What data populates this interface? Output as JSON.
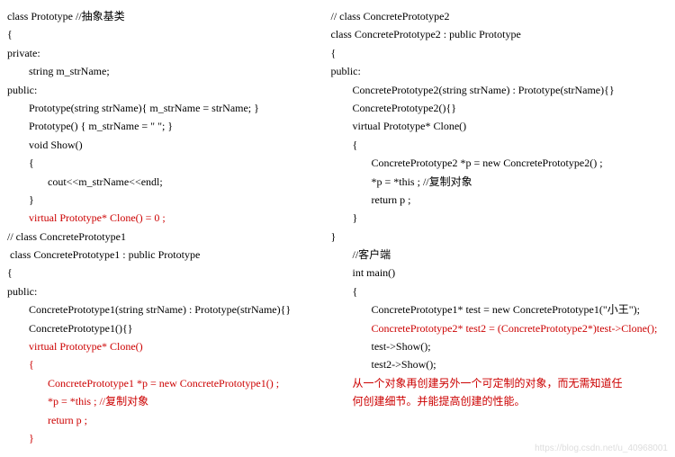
{
  "left": {
    "l1": "class Prototype //抽象基类",
    "l2": "{",
    "l3": "private:",
    "l4": "        string m_strName;",
    "l5": "public:",
    "l6": "        Prototype(string strName){ m_strName = strName; }",
    "l7": "        Prototype() { m_strName = \" \"; }",
    "l8": "        void Show()",
    "l9": "        {",
    "l10": "               cout<<m_strName<<endl;",
    "l11": "        }",
    "l12": "        virtual Prototype* Clone() = 0 ;",
    "l13": "",
    "l14": "// class ConcretePrototype1",
    "l15": " class ConcretePrototype1 : public Prototype",
    "l16": "{",
    "l17": "public:",
    "l18": "        ConcretePrototype1(string strName) : Prototype(strName){}",
    "l19": "        ConcretePrototype1(){}",
    "l20": "",
    "l21": "        virtual Prototype* Clone()",
    "l22": "        {",
    "l23": "               ConcretePrototype1 *p = new ConcretePrototype1() ;",
    "l24": "               *p = *this ; //复制对象",
    "l25": "               return p ;",
    "l26": "        }"
  },
  "right": {
    "r1": "// class ConcretePrototype2",
    "r2": "class ConcretePrototype2 : public Prototype",
    "r3": "{",
    "r4": "public:",
    "r5": "        ConcretePrototype2(string strName) : Prototype(strName){}",
    "r6": "        ConcretePrototype2(){}",
    "r7": "",
    "r8": "        virtual Prototype* Clone()",
    "r9": "        {",
    "r10": "               ConcretePrototype2 *p = new ConcretePrototype2() ;",
    "r11": "               *p = *this ; //复制对象",
    "r12": "               return p ;",
    "r13": "        }",
    "r14": "}",
    "r15": "",
    "r16": "",
    "r17": "        //客户端",
    "r18": "        int main()",
    "r19": "        {",
    "r20": "               ConcretePrototype1* test = new ConcretePrototype1(\"小王\");",
    "r21": "               ConcretePrototype2* test2 = (ConcretePrototype2*)test->Clone();",
    "r22": "               test->Show();",
    "r23": "               test2->Show();",
    "r24": "",
    "r25": "        从一个对象再创建另外一个可定制的对象，而无需知道任",
    "r26": "        何创建细节。并能提高创建的性能。"
  },
  "watermark": "https://blog.csdn.net/u_40968001"
}
